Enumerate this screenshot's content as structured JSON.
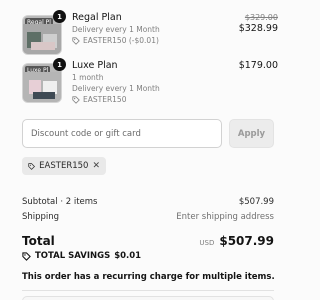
{
  "cart": {
    "items": [
      {
        "thumb_label": "Regal Pl",
        "quantity": "1",
        "name": "Regal Plan",
        "frequency": "Delivery every 1 Month",
        "discount": "EASTER150 (-$0.01)",
        "price_original": "$329.00",
        "price": "$328.99"
      },
      {
        "thumb_label": "Luxe Pl",
        "quantity": "1",
        "name": "Luxe Plan",
        "frequency_line1": "1 month",
        "frequency": "Delivery every 1 Month",
        "discount": "EASTER150",
        "price": "$179.00"
      }
    ]
  },
  "discount": {
    "placeholder": "Discount code or gift card",
    "apply_label": "Apply",
    "applied_code": "EASTER150"
  },
  "summary": {
    "subtotal_label": "Subtotal · 2 items",
    "subtotal_value": "$507.99",
    "shipping_label": "Shipping",
    "shipping_value": "Enter shipping address",
    "total_label": "Total",
    "currency": "USD",
    "total_value": "$507.99",
    "savings_label": "TOTAL SAVINGS",
    "savings_value": "$0.01",
    "recurring_note": "This order has a recurring charge for multiple items."
  },
  "colors": {
    "text": "#141414",
    "muted": "#808080",
    "chip_bg": "#e9e9e9",
    "button_bg": "#ececec"
  }
}
